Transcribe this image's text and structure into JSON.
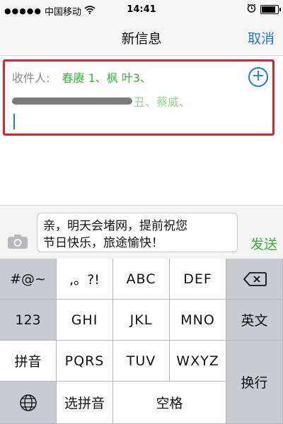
{
  "status_bar": {
    "signal": "●●●●●",
    "carrier": "中国移动",
    "wifi_icon": "wifi-icon",
    "time": "14:41",
    "alarm_icon": "alarm-icon",
    "battery_level": 0.85
  },
  "nav": {
    "title": "新信息",
    "cancel_label": "取消"
  },
  "recipients": {
    "label": "收件人:",
    "row1_names": "春赓 1、枫 叶3、",
    "row2_names": "丑、蔡威、",
    "add_icon": "add-contact-icon"
  },
  "compose": {
    "camera_icon": "camera-icon",
    "message_line1": "亲，明天会堵网，提前祝您",
    "message_line2": "节日快乐，旅途愉快！",
    "send_label": "发送"
  },
  "keyboard": {
    "symbols": "#@~",
    "punct": ",。?!",
    "abc": "ABC",
    "def": "DEF",
    "backspace_icon": "backspace-icon",
    "num": "123",
    "ghi": "GHI",
    "jkl": "JKL",
    "mno": "MNO",
    "english": "英文",
    "pinyin": "拼音",
    "pqrs": "PQRS",
    "tuv": "TUV",
    "wxyz": "WXYZ",
    "globe_icon": "globe-icon",
    "select_pinyin": "选拼音",
    "space": "空格",
    "newline": "换行"
  }
}
